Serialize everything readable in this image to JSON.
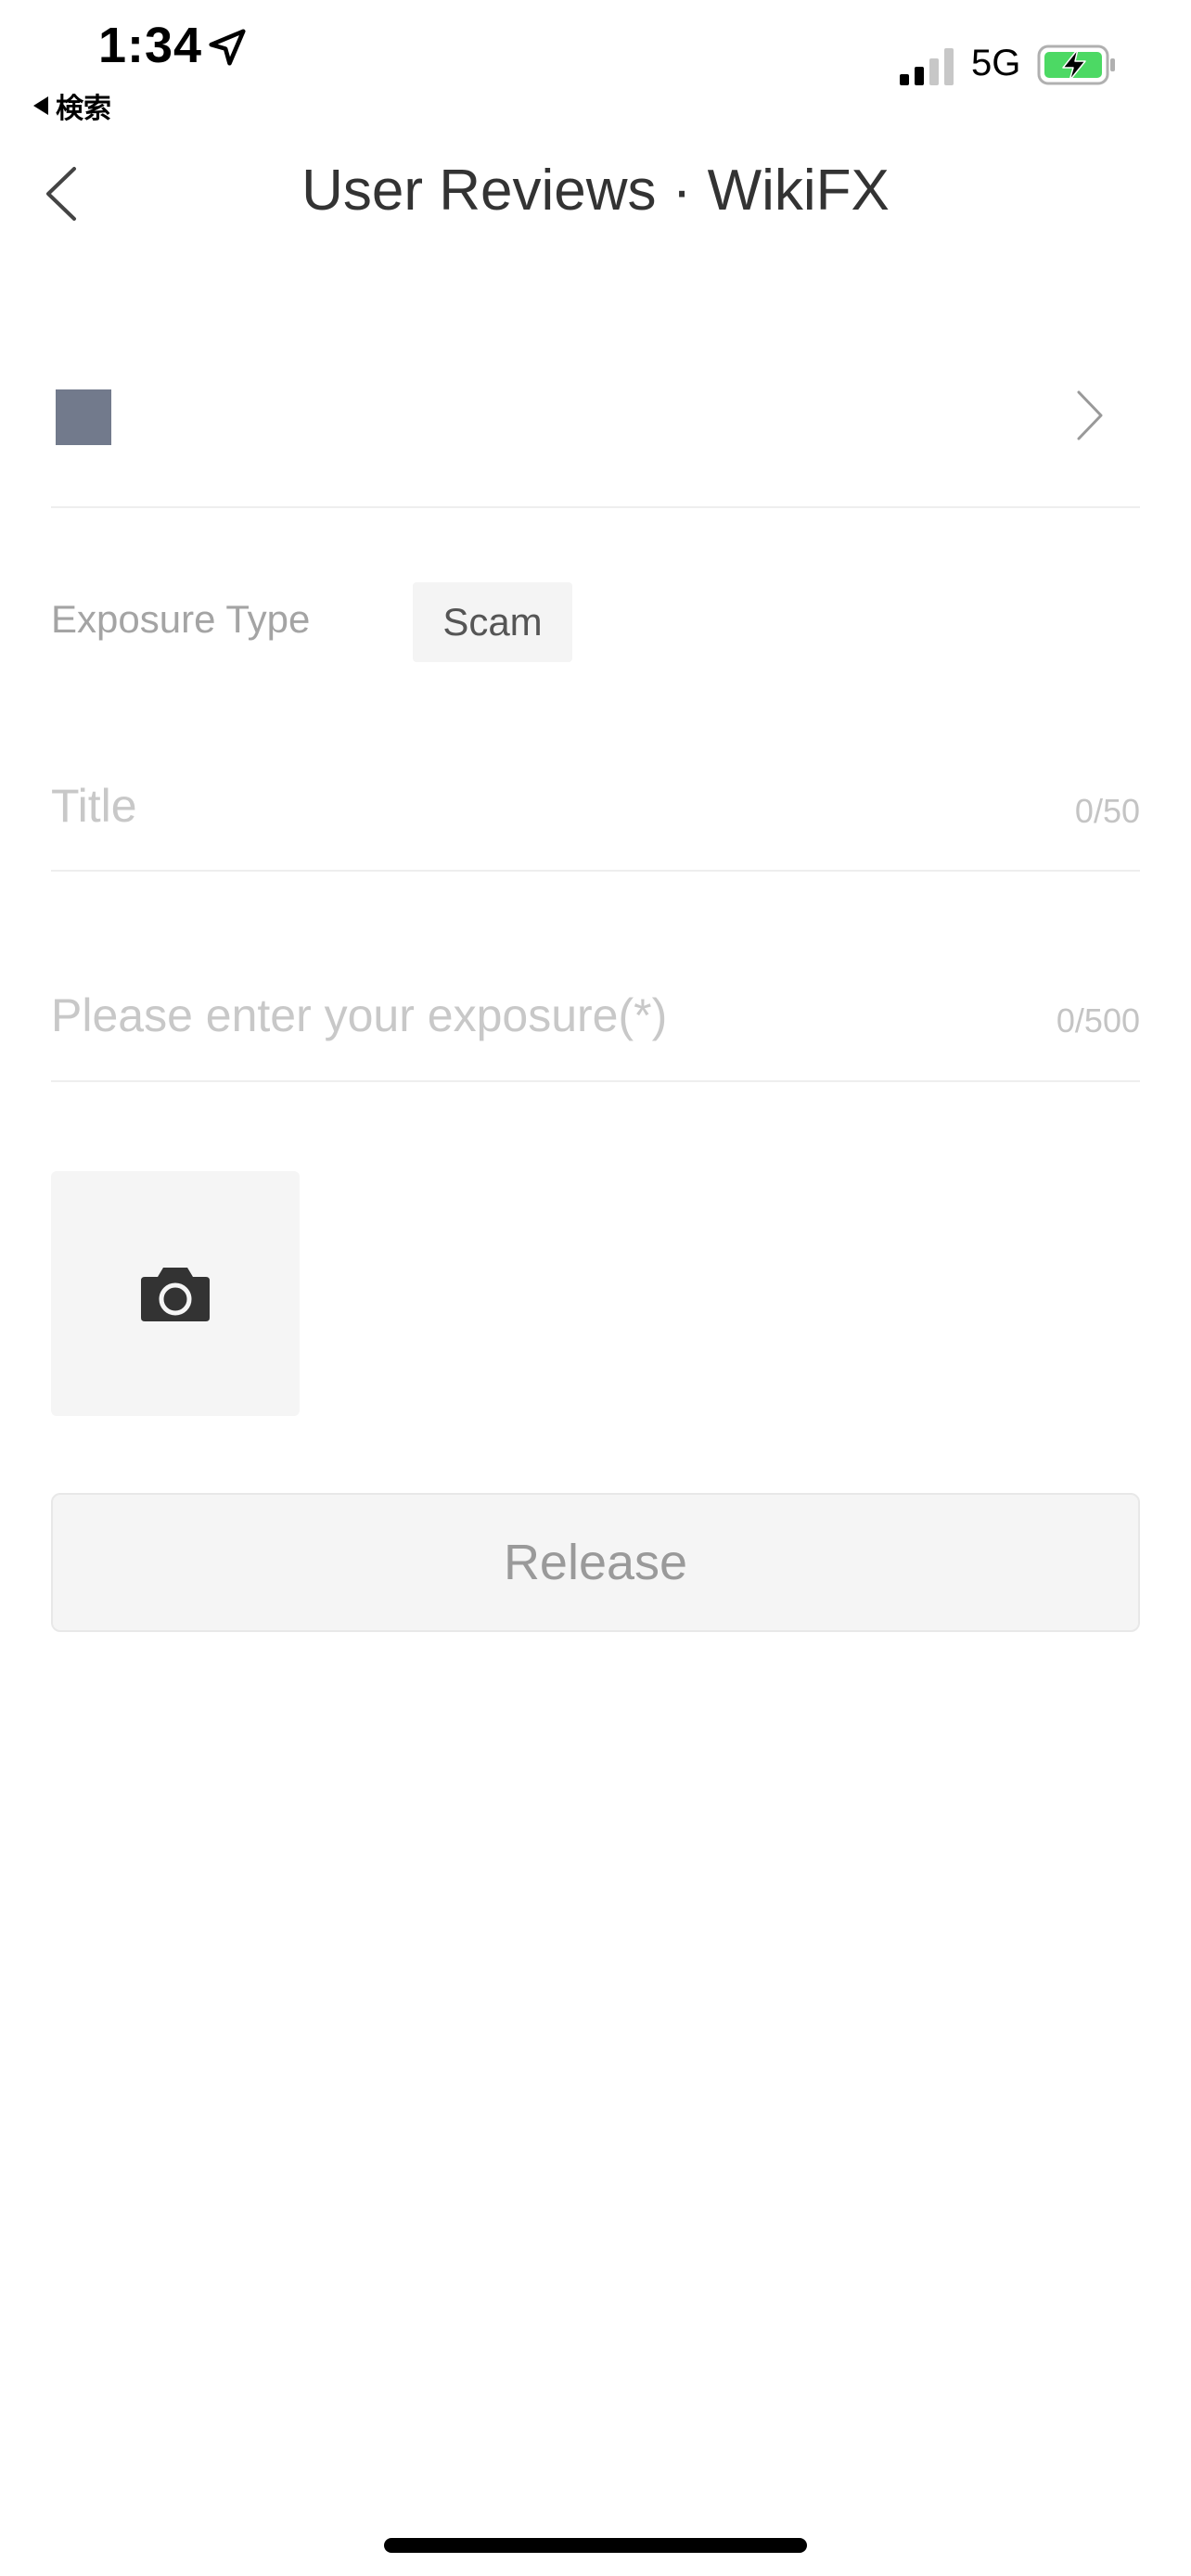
{
  "status_bar": {
    "time": "1:34",
    "back_app": "検索",
    "network": "5G",
    "battery_color": "#4cd964"
  },
  "header": {
    "title": "User Reviews · WikiFX"
  },
  "broker": {
    "avatar_color": "#727a8c"
  },
  "form": {
    "exposure_type_label": "Exposure Type",
    "exposure_type_value": "Scam",
    "title_placeholder": "Title",
    "title_counter": "0/50",
    "content_placeholder": "Please enter your exposure(*)",
    "content_counter": "0/500"
  },
  "actions": {
    "release_label": "Release"
  }
}
